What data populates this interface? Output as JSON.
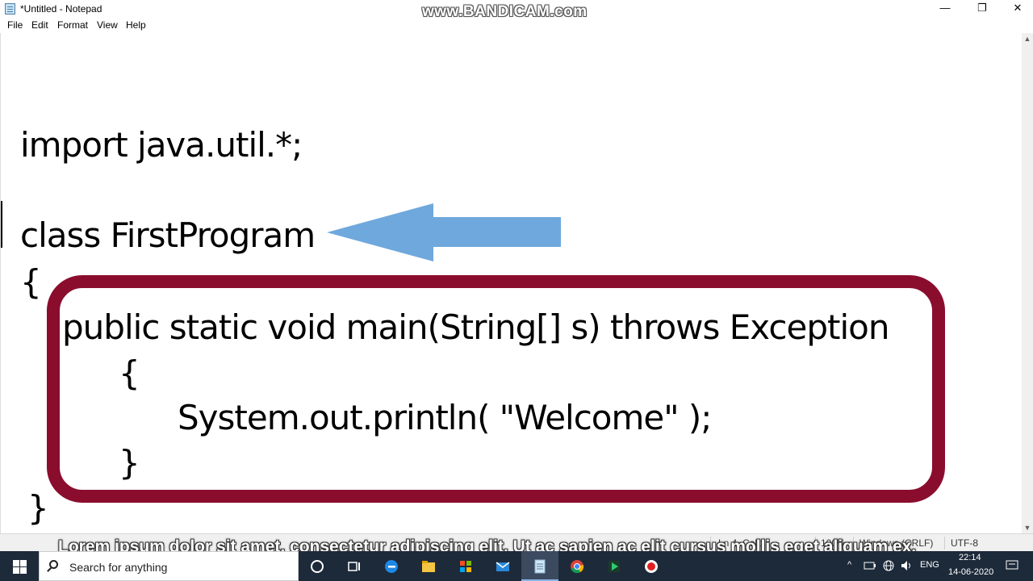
{
  "window": {
    "title": "*Untitled - Notepad",
    "minimize": "—",
    "maximize": "❐",
    "close": "✕"
  },
  "watermark": "www.BANDICAM.com",
  "menu": [
    "File",
    "Edit",
    "Format",
    "View",
    "Help"
  ],
  "editor": {
    "lines": [
      "import java.util.*;",
      "class FirstProgram",
      "{",
      "public static void main(String[] s) throws Exception",
      "{",
      "System.out.println( \"Welcome\" );",
      "}",
      "}"
    ],
    "colors": {
      "arrow": "#6fa8dc",
      "box": "#8a0d2e"
    }
  },
  "statusbar": {
    "position": "Ln 4, Col 1",
    "zoom": "100%",
    "line_ending": "Windows (CRLF)",
    "encoding": "UTF-8"
  },
  "overlay_text": "Lorem ipsum dolor sit amet, consectetur adipiscing elit. Ut ac sapien ac elit cursus mollis eget aliquam ex.",
  "taskbar": {
    "search_placeholder": "Search for anything",
    "apps": [
      "task-view",
      "edge",
      "file-explorer",
      "store",
      "mail",
      "notepad",
      "chrome",
      "app-green",
      "record"
    ],
    "tray": {
      "chevron": "^",
      "language": "ENG",
      "time": "22:14",
      "date": "14-06-2020"
    }
  }
}
